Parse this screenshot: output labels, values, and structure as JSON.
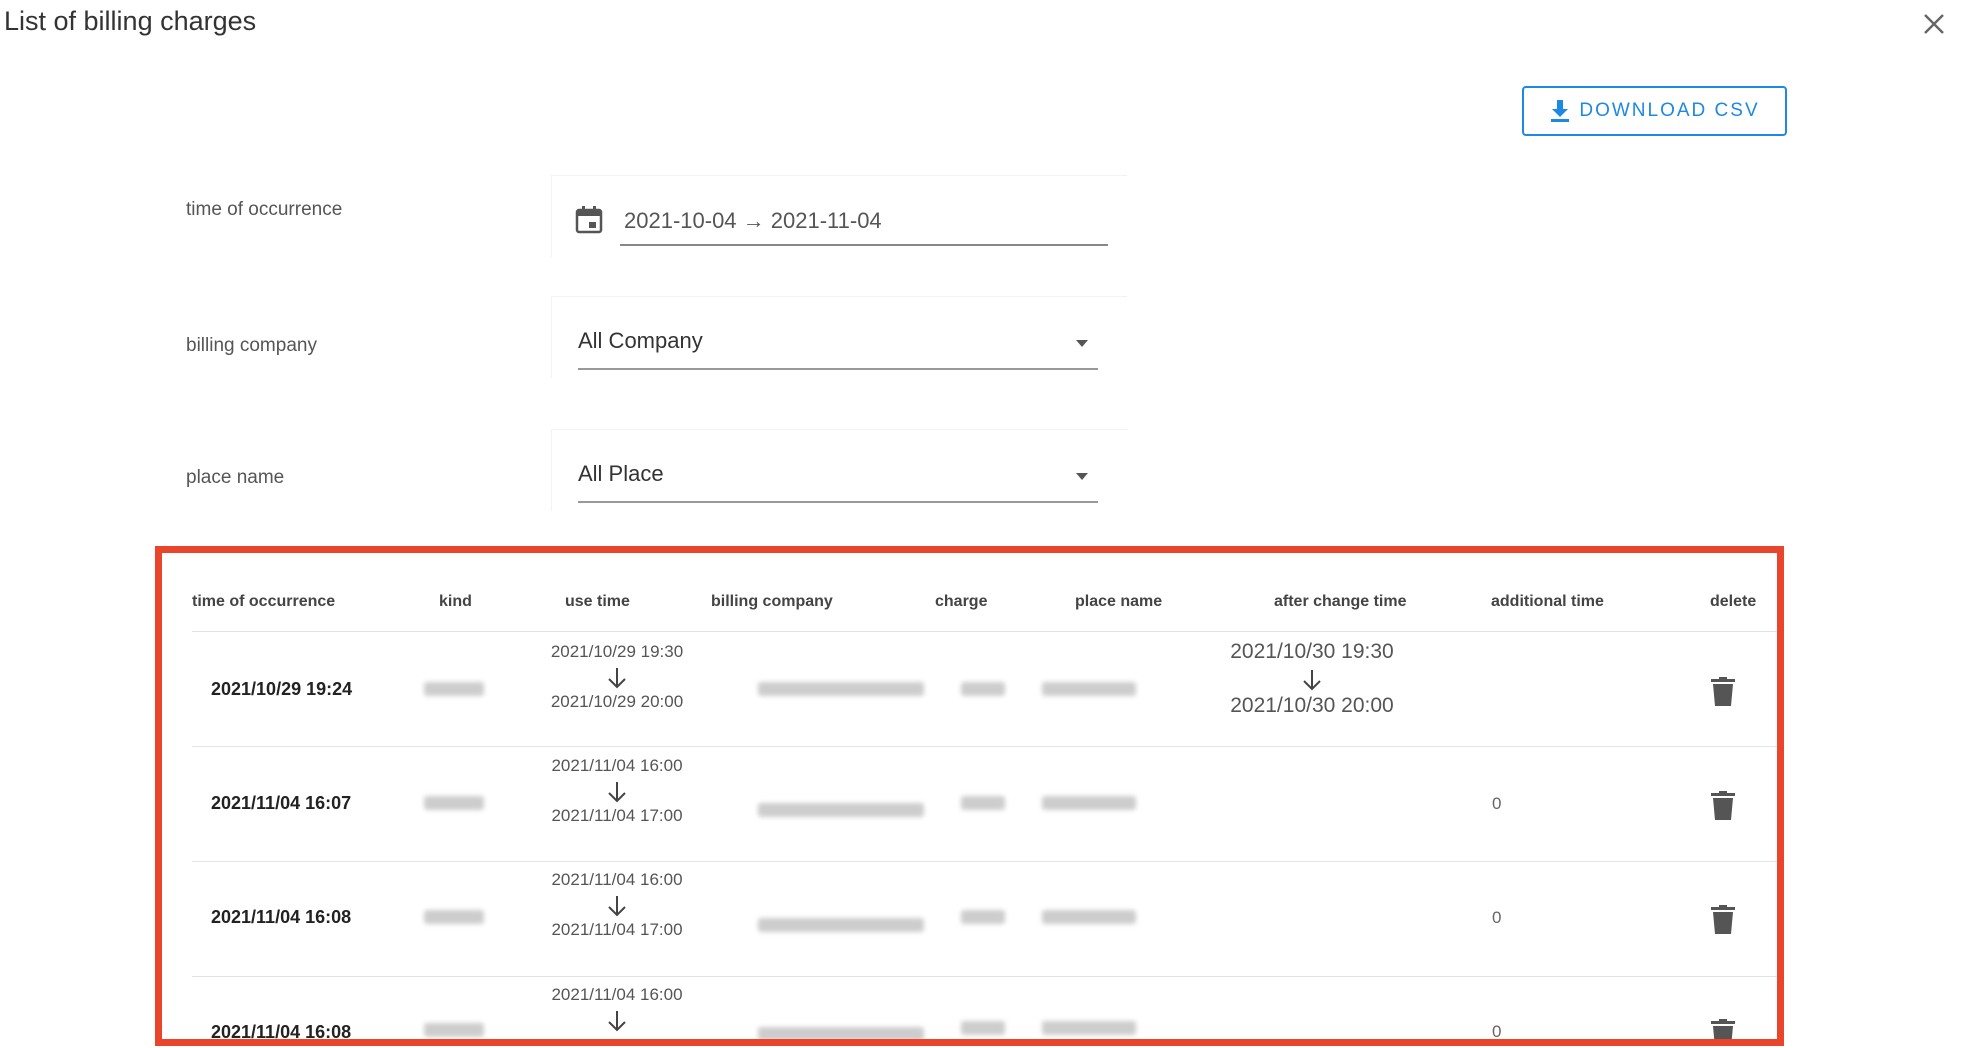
{
  "dialog": {
    "title": "List of billing charges"
  },
  "toolbar": {
    "download_csv_label": "DOWNLOAD CSV"
  },
  "filters": {
    "time_of_occurrence_label": "time of occurrence",
    "date_range_value": "2021-10-04 → 2021-11-04",
    "billing_company_label": "billing company",
    "billing_company_value": "All Company",
    "place_name_label": "place name",
    "place_name_value": "All Place"
  },
  "table": {
    "headers": {
      "time_of_occurrence": "time of occurrence",
      "kind": "kind",
      "use_time": "use time",
      "billing_company": "billing company",
      "charge": "charge",
      "place_name": "place name",
      "after_change_time": "after change time",
      "additional_time": "additional time",
      "delete": "delete"
    },
    "rows": [
      {
        "time": "2021/10/29 19:24",
        "use_from": "2021/10/29 19:30",
        "use_to": "2021/10/29 20:00",
        "after_from": "2021/10/30 19:30",
        "after_to": "2021/10/30 20:00",
        "additional": ""
      },
      {
        "time": "2021/11/04 16:07",
        "use_from": "2021/11/04 16:00",
        "use_to": "2021/11/04 17:00",
        "after_from": "",
        "after_to": "",
        "additional": "0"
      },
      {
        "time": "2021/11/04 16:08",
        "use_from": "2021/11/04 16:00",
        "use_to": "2021/11/04 17:00",
        "after_from": "",
        "after_to": "",
        "additional": "0"
      },
      {
        "time": "2021/11/04 16:08",
        "use_from": "2021/11/04 16:00",
        "use_to": "",
        "after_from": "",
        "after_to": "",
        "additional": "0"
      }
    ]
  },
  "colors": {
    "accent": "#1e88e5",
    "highlight_border": "#e8452c"
  },
  "icons": [
    "close-icon",
    "download-icon",
    "calendar-icon",
    "chevron-down-icon",
    "arrow-down-icon",
    "trash-icon"
  ]
}
